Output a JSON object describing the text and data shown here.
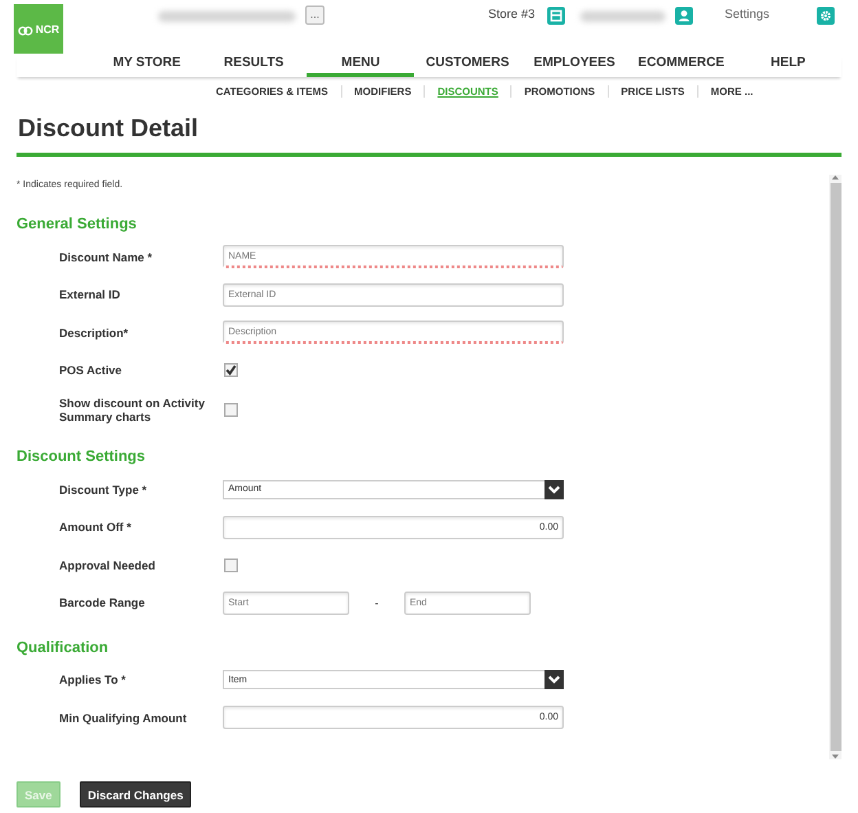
{
  "header": {
    "logo": "NCR",
    "more_button": "...",
    "store": "Store #3",
    "settings": "Settings"
  },
  "nav": [
    {
      "label": "MY STORE",
      "selected": false
    },
    {
      "label": "RESULTS",
      "selected": false
    },
    {
      "label": "MENU",
      "selected": true
    },
    {
      "label": "CUSTOMERS",
      "selected": false
    },
    {
      "label": "EMPLOYEES",
      "selected": false
    },
    {
      "label": "ECOMMERCE",
      "selected": false
    },
    {
      "label": "HELP",
      "selected": false
    }
  ],
  "subnav": [
    {
      "label": "CATEGORIES & ITEMS",
      "selected": false
    },
    {
      "label": "MODIFIERS",
      "selected": false
    },
    {
      "label": "DISCOUNTS",
      "selected": true
    },
    {
      "label": "PROMOTIONS",
      "selected": false
    },
    {
      "label": "PRICE LISTS",
      "selected": false
    },
    {
      "label": "MORE ...",
      "selected": false
    }
  ],
  "page_title": "Discount Detail",
  "required_note": "* Indicates required field.",
  "sections": [
    {
      "title": "General Settings",
      "rows": [
        {
          "kind": "text",
          "label": "Discount Name *",
          "placeholder": "NAME",
          "invalid": true
        },
        {
          "kind": "text",
          "label": "External ID",
          "placeholder": "External ID",
          "invalid": false
        },
        {
          "kind": "text",
          "label": "Description*",
          "placeholder": "Description",
          "invalid": true
        },
        {
          "kind": "checkbox",
          "label": "POS Active",
          "checked": true
        },
        {
          "kind": "checkbox",
          "label": "Show discount on Activity Summary charts",
          "checked": false
        }
      ]
    },
    {
      "title": "Discount Settings",
      "rows": [
        {
          "kind": "select",
          "label": "Discount Type *",
          "value": "Amount"
        },
        {
          "kind": "number",
          "label": "Amount Off *",
          "value": "0.00"
        },
        {
          "kind": "checkbox",
          "label": "Approval Needed",
          "checked": false
        },
        {
          "kind": "range",
          "label": "Barcode Range",
          "start_placeholder": "Start",
          "separator": "-",
          "end_placeholder": "End"
        }
      ]
    },
    {
      "title": "Qualification",
      "rows": [
        {
          "kind": "select",
          "label": "Applies To *",
          "value": "Item"
        },
        {
          "kind": "number",
          "label": "Min Qualifying Amount",
          "value": "0.00"
        }
      ]
    }
  ],
  "buttons": [
    {
      "label": "Save",
      "disabled": true
    },
    {
      "label": "Discard Changes",
      "disabled": false
    }
  ]
}
